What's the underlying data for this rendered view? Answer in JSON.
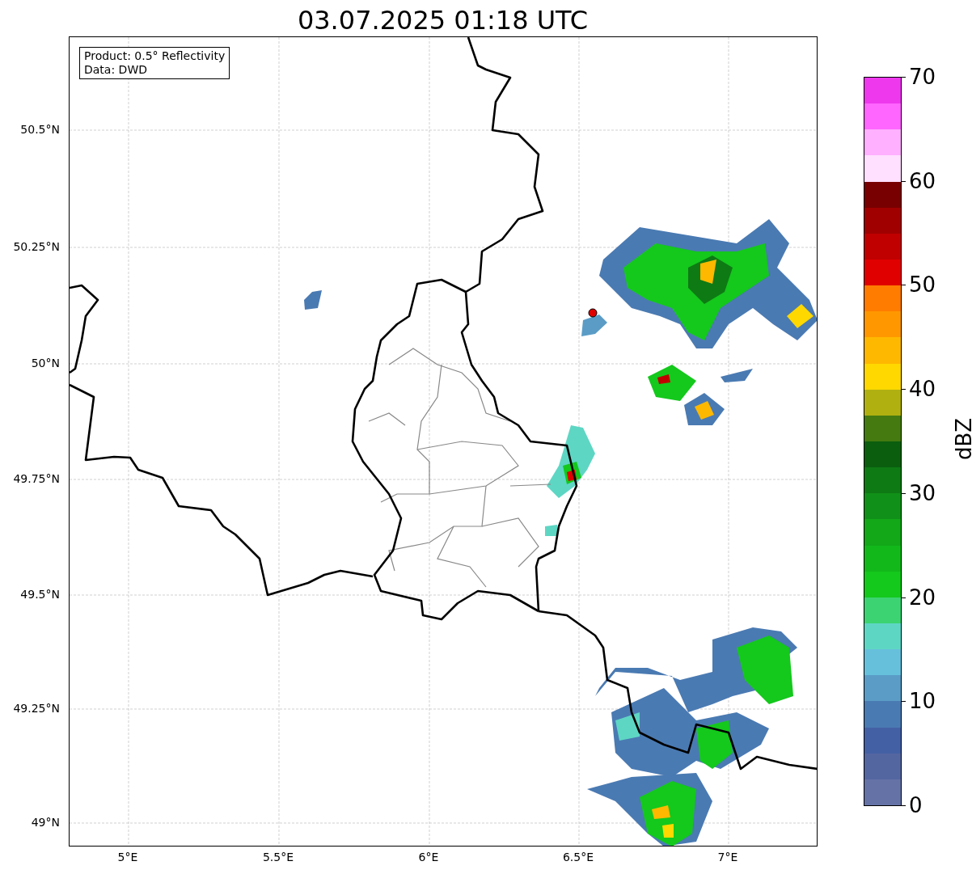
{
  "title": "03.07.2025 01:18 UTC",
  "info_box": {
    "lines": [
      "Product: 0.5° Reflectivity",
      "Data: DWD"
    ]
  },
  "y_ticks": [
    "50.5°N",
    "50.25°N",
    "50°N",
    "49.75°N",
    "49.5°N",
    "49.25°N",
    "49°N"
  ],
  "x_ticks": [
    "5°E",
    "5.5°E",
    "6°E",
    "6.5°E",
    "7°E"
  ],
  "colorbar": {
    "label": "dBZ",
    "ticks": [
      "70",
      "60",
      "50",
      "40",
      "30",
      "20",
      "10",
      "0"
    ],
    "bands": [
      {
        "color": "#ee38ee"
      },
      {
        "color": "#ff66ff"
      },
      {
        "color": "#ffb0ff"
      },
      {
        "color": "#ffe0ff"
      },
      {
        "color": "#780000"
      },
      {
        "color": "#a00000"
      },
      {
        "color": "#c00000"
      },
      {
        "color": "#e00000"
      },
      {
        "color": "#ff7c00"
      },
      {
        "color": "#ff9800"
      },
      {
        "color": "#ffb800"
      },
      {
        "color": "#ffd800"
      },
      {
        "color": "#b0b010"
      },
      {
        "color": "#447a10"
      },
      {
        "color": "#0a5e0e"
      },
      {
        "color": "#0e7a14"
      },
      {
        "color": "#109018"
      },
      {
        "color": "#12a818"
      },
      {
        "color": "#12b81a"
      },
      {
        "color": "#14c81c"
      },
      {
        "color": "#3cd472"
      },
      {
        "color": "#5ed6c4"
      },
      {
        "color": "#66c0dc"
      },
      {
        "color": "#5a9cc6"
      },
      {
        "color": "#4a7ab2"
      },
      {
        "color": "#4460a4"
      },
      {
        "color": "#5466a0"
      },
      {
        "color": "#6472a6"
      }
    ]
  }
}
